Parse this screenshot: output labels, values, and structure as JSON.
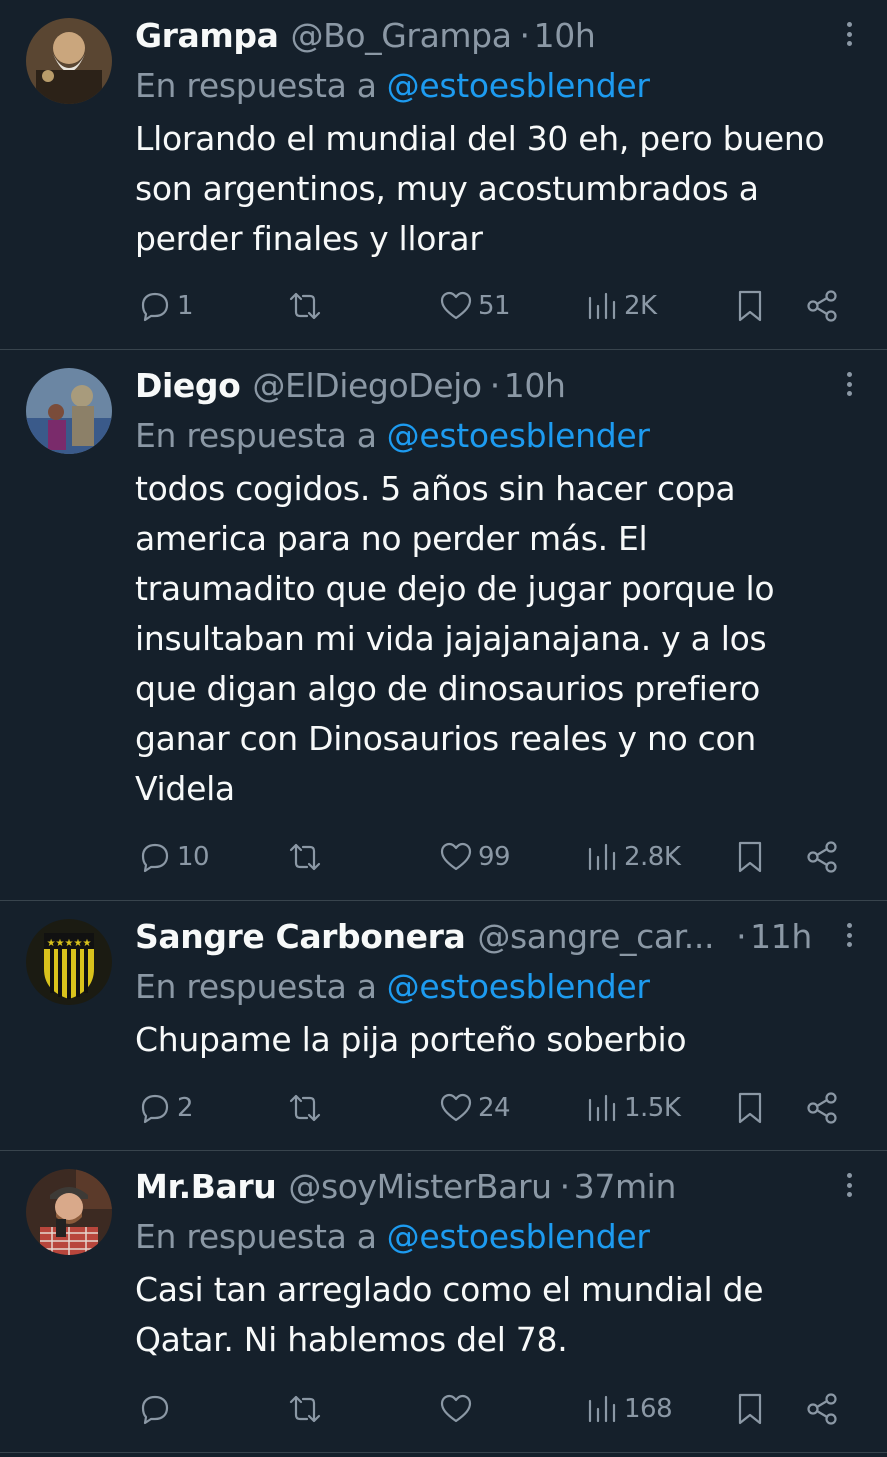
{
  "reply_prefix": "En respuesta a",
  "tweets": [
    {
      "name": "Grampa",
      "handle": "@Bo_Grampa",
      "time": "10h",
      "reply_to": "@estoesblender",
      "text": "Llorando el mundial del 30 eh, pero bueno\nson argentinos, muy acostumbrados a\nperder finales y llorar",
      "replies": "1",
      "retweets": "",
      "likes": "51",
      "views": "2K",
      "avatar_icon": "avatar-bearded-man"
    },
    {
      "name": "Diego",
      "handle": "@ElDiegoDejo",
      "time": "10h",
      "reply_to": "@estoesblender",
      "text": "todos cogidos. 5 años sin hacer copa\namerica para no perder más. El\ntraumadito que dejo de jugar porque lo\ninsultaban mi vida jajajanajana. y a los\nque digan algo de dinosaurios prefiero\nganar con Dinosaurios reales y no con\nVidela",
      "replies": "10",
      "retweets": "",
      "likes": "99",
      "views": "2.8K",
      "avatar_icon": "avatar-statue"
    },
    {
      "name": "Sangre Carbonera",
      "handle": "@sangre_car...",
      "time": "11h",
      "reply_to": "@estoesblender",
      "text": "Chupame la pija porteño soberbio",
      "replies": "2",
      "retweets": "",
      "likes": "24",
      "views": "1.5K",
      "avatar_icon": "avatar-club-crest"
    },
    {
      "name": "Mr.Baru",
      "handle": "@soyMisterBaru",
      "time": "37min",
      "reply_to": "@estoesblender",
      "text": "Casi tan arreglado como el mundial de\nQatar. Ni hablemos del 78.",
      "replies": "",
      "retweets": "",
      "likes": "",
      "views": "168",
      "avatar_icon": "avatar-man-cap"
    }
  ],
  "colors": {
    "background": "#15202b",
    "text": "#f7f9f9",
    "secondary": "#8b98a5",
    "link": "#1d9bf0",
    "divider": "#38444d"
  }
}
